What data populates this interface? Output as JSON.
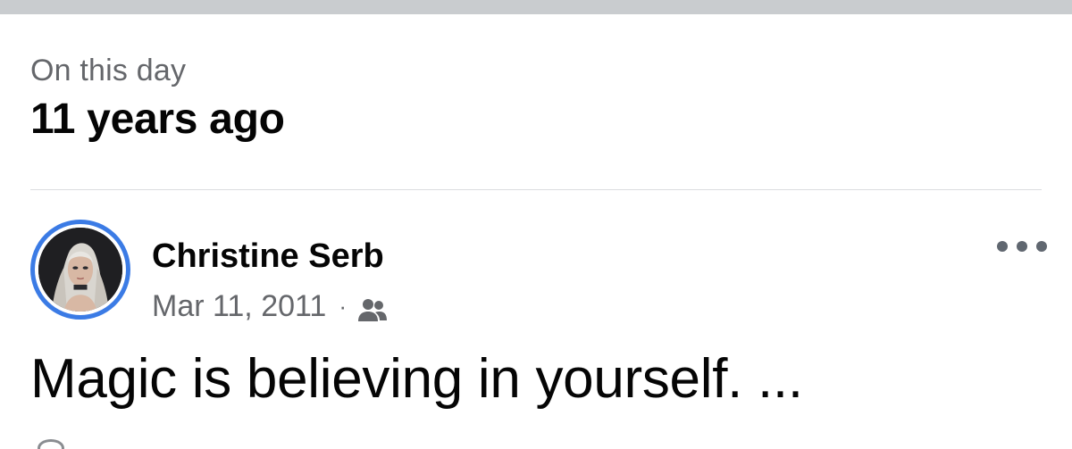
{
  "memory": {
    "label": "On this day",
    "time_ago": "11 years ago"
  },
  "post": {
    "author_name": "Christine Serb",
    "date": "Mar 11, 2011",
    "separator": "·",
    "audience_icon": "friends-icon",
    "text": "Magic is believing in yourself. ...",
    "more_icon": "more-horizontal-icon",
    "avatar_ring_color": "#3b7be5"
  }
}
